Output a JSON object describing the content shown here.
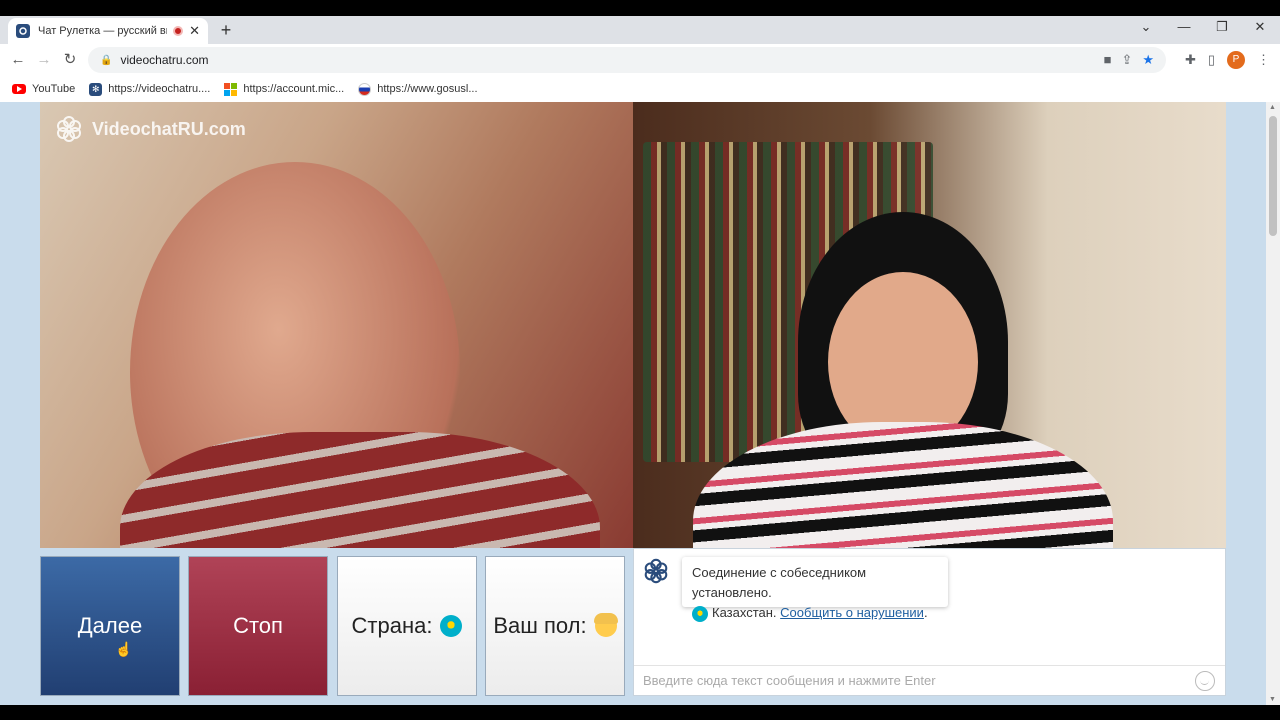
{
  "browser": {
    "tab_title": "Чат Рулетка — русский вид",
    "tab_close": "✕",
    "new_tab": "+",
    "url": "videochatru.com",
    "bookmarks": [
      {
        "label": "YouTube",
        "icon": "youtube-icon"
      },
      {
        "label": "https://videochatru....",
        "icon": "videochat-icon"
      },
      {
        "label": "https://account.mic...",
        "icon": "microsoft-icon"
      },
      {
        "label": "https://www.gosusl...",
        "icon": "gosuslugi-icon"
      }
    ],
    "profile_initial": "P"
  },
  "page": {
    "logo_text": "VideochatRU.com",
    "buttons": {
      "next": "Далее",
      "stop": "Стоп",
      "country": "Страна:",
      "gender": "Ваш пол:"
    },
    "chat": {
      "system_message": "Соединение с собеседником установлено.",
      "country": "Казахстан.",
      "report_link": "Сообщить о нарушении",
      "period": ".",
      "input_placeholder": "Введите сюда текст сообщения и нажмите Enter"
    }
  },
  "colors": {
    "next_button": "#2c5189",
    "stop_button": "#9c2e43",
    "page_background": "#c9dcec",
    "link": "#1f5fa0"
  }
}
